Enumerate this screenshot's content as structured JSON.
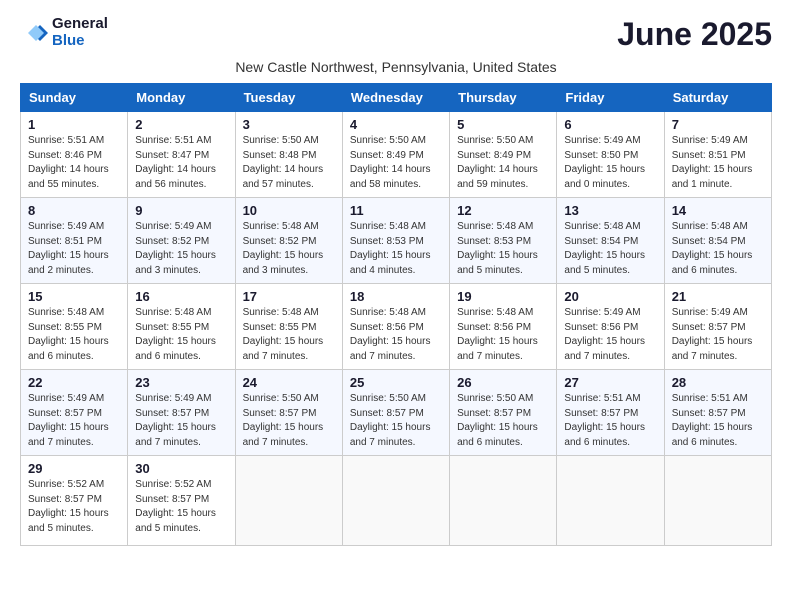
{
  "header": {
    "logo_general": "General",
    "logo_blue": "Blue",
    "month_title": "June 2025",
    "location": "New Castle Northwest, Pennsylvania, United States"
  },
  "days_of_week": [
    "Sunday",
    "Monday",
    "Tuesday",
    "Wednesday",
    "Thursday",
    "Friday",
    "Saturday"
  ],
  "weeks": [
    [
      {
        "day": "1",
        "info": "Sunrise: 5:51 AM\nSunset: 8:46 PM\nDaylight: 14 hours\nand 55 minutes."
      },
      {
        "day": "2",
        "info": "Sunrise: 5:51 AM\nSunset: 8:47 PM\nDaylight: 14 hours\nand 56 minutes."
      },
      {
        "day": "3",
        "info": "Sunrise: 5:50 AM\nSunset: 8:48 PM\nDaylight: 14 hours\nand 57 minutes."
      },
      {
        "day": "4",
        "info": "Sunrise: 5:50 AM\nSunset: 8:49 PM\nDaylight: 14 hours\nand 58 minutes."
      },
      {
        "day": "5",
        "info": "Sunrise: 5:50 AM\nSunset: 8:49 PM\nDaylight: 14 hours\nand 59 minutes."
      },
      {
        "day": "6",
        "info": "Sunrise: 5:49 AM\nSunset: 8:50 PM\nDaylight: 15 hours\nand 0 minutes."
      },
      {
        "day": "7",
        "info": "Sunrise: 5:49 AM\nSunset: 8:51 PM\nDaylight: 15 hours\nand 1 minute."
      }
    ],
    [
      {
        "day": "8",
        "info": "Sunrise: 5:49 AM\nSunset: 8:51 PM\nDaylight: 15 hours\nand 2 minutes."
      },
      {
        "day": "9",
        "info": "Sunrise: 5:49 AM\nSunset: 8:52 PM\nDaylight: 15 hours\nand 3 minutes."
      },
      {
        "day": "10",
        "info": "Sunrise: 5:48 AM\nSunset: 8:52 PM\nDaylight: 15 hours\nand 3 minutes."
      },
      {
        "day": "11",
        "info": "Sunrise: 5:48 AM\nSunset: 8:53 PM\nDaylight: 15 hours\nand 4 minutes."
      },
      {
        "day": "12",
        "info": "Sunrise: 5:48 AM\nSunset: 8:53 PM\nDaylight: 15 hours\nand 5 minutes."
      },
      {
        "day": "13",
        "info": "Sunrise: 5:48 AM\nSunset: 8:54 PM\nDaylight: 15 hours\nand 5 minutes."
      },
      {
        "day": "14",
        "info": "Sunrise: 5:48 AM\nSunset: 8:54 PM\nDaylight: 15 hours\nand 6 minutes."
      }
    ],
    [
      {
        "day": "15",
        "info": "Sunrise: 5:48 AM\nSunset: 8:55 PM\nDaylight: 15 hours\nand 6 minutes."
      },
      {
        "day": "16",
        "info": "Sunrise: 5:48 AM\nSunset: 8:55 PM\nDaylight: 15 hours\nand 6 minutes."
      },
      {
        "day": "17",
        "info": "Sunrise: 5:48 AM\nSunset: 8:55 PM\nDaylight: 15 hours\nand 7 minutes."
      },
      {
        "day": "18",
        "info": "Sunrise: 5:48 AM\nSunset: 8:56 PM\nDaylight: 15 hours\nand 7 minutes."
      },
      {
        "day": "19",
        "info": "Sunrise: 5:48 AM\nSunset: 8:56 PM\nDaylight: 15 hours\nand 7 minutes."
      },
      {
        "day": "20",
        "info": "Sunrise: 5:49 AM\nSunset: 8:56 PM\nDaylight: 15 hours\nand 7 minutes."
      },
      {
        "day": "21",
        "info": "Sunrise: 5:49 AM\nSunset: 8:57 PM\nDaylight: 15 hours\nand 7 minutes."
      }
    ],
    [
      {
        "day": "22",
        "info": "Sunrise: 5:49 AM\nSunset: 8:57 PM\nDaylight: 15 hours\nand 7 minutes."
      },
      {
        "day": "23",
        "info": "Sunrise: 5:49 AM\nSunset: 8:57 PM\nDaylight: 15 hours\nand 7 minutes."
      },
      {
        "day": "24",
        "info": "Sunrise: 5:50 AM\nSunset: 8:57 PM\nDaylight: 15 hours\nand 7 minutes."
      },
      {
        "day": "25",
        "info": "Sunrise: 5:50 AM\nSunset: 8:57 PM\nDaylight: 15 hours\nand 7 minutes."
      },
      {
        "day": "26",
        "info": "Sunrise: 5:50 AM\nSunset: 8:57 PM\nDaylight: 15 hours\nand 6 minutes."
      },
      {
        "day": "27",
        "info": "Sunrise: 5:51 AM\nSunset: 8:57 PM\nDaylight: 15 hours\nand 6 minutes."
      },
      {
        "day": "28",
        "info": "Sunrise: 5:51 AM\nSunset: 8:57 PM\nDaylight: 15 hours\nand 6 minutes."
      }
    ],
    [
      {
        "day": "29",
        "info": "Sunrise: 5:52 AM\nSunset: 8:57 PM\nDaylight: 15 hours\nand 5 minutes."
      },
      {
        "day": "30",
        "info": "Sunrise: 5:52 AM\nSunset: 8:57 PM\nDaylight: 15 hours\nand 5 minutes."
      },
      {
        "day": "",
        "info": ""
      },
      {
        "day": "",
        "info": ""
      },
      {
        "day": "",
        "info": ""
      },
      {
        "day": "",
        "info": ""
      },
      {
        "day": "",
        "info": ""
      }
    ]
  ]
}
